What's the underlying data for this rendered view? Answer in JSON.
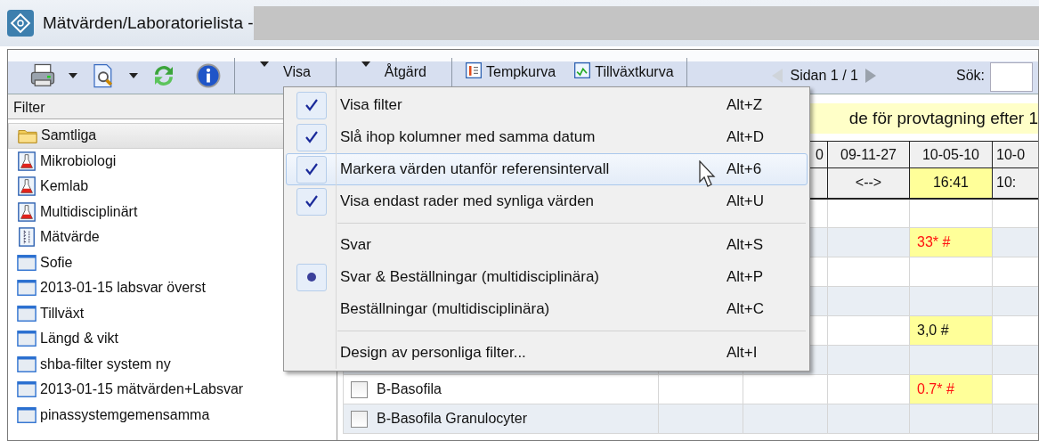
{
  "window": {
    "title": "Mätvärden/Laboratorielista -"
  },
  "toolbar": {
    "items": [
      {
        "kind": "printer"
      },
      {
        "kind": "caret"
      },
      {
        "kind": "preview"
      },
      {
        "kind": "caret"
      },
      {
        "kind": "refresh"
      },
      {
        "kind": "info"
      },
      {
        "kind": "separator"
      },
      {
        "kind": "menu",
        "label": "Visa"
      },
      {
        "kind": "separator"
      },
      {
        "kind": "menu",
        "label": "Åtgärd"
      },
      {
        "kind": "separator"
      },
      {
        "kind": "temp",
        "label": "Tempkurva"
      },
      {
        "kind": "growth",
        "label": "Tillväxtkurva"
      },
      {
        "kind": "separator"
      }
    ],
    "pager": {
      "label": "Sidan 1 / 1",
      "prev_disabled": true,
      "next_disabled": false
    },
    "search": {
      "label": "Sök:"
    }
  },
  "sidebar": {
    "header": "Filter",
    "items": [
      {
        "label": "Samtliga",
        "kind": "folder",
        "selected": true
      },
      {
        "label": "Mikrobiologi",
        "kind": "flask",
        "selected": false
      },
      {
        "label": "Kemlab",
        "kind": "flask",
        "selected": false
      },
      {
        "label": "Multidisciplinärt",
        "kind": "flask",
        "selected": false
      },
      {
        "label": "Mätvärde",
        "kind": "ruler",
        "selected": false
      },
      {
        "label": "Sofie",
        "kind": "window",
        "selected": false
      },
      {
        "label": "2013-01-15 labsvar överst",
        "kind": "window",
        "selected": false
      },
      {
        "label": "Tillväxt",
        "kind": "window",
        "selected": false
      },
      {
        "label": "Längd & vikt",
        "kind": "window",
        "selected": false
      },
      {
        "label": "shba-filter system ny",
        "kind": "window",
        "selected": false
      },
      {
        "label": "2013-01-15 mätvärden+Labsvar",
        "kind": "window",
        "selected": false
      },
      {
        "label": "pinassystemgemensamma",
        "kind": "window",
        "selected": false
      }
    ]
  },
  "banner": {
    "text": "de för provtagning efter 1"
  },
  "table": {
    "date_row": [
      "0",
      "09-11-27",
      "10-05-10",
      "10-0"
    ],
    "time_row": [
      {
        "text": "<-->",
        "highlight": false
      },
      {
        "text": "16:41",
        "highlight": true
      },
      {
        "text": "10:",
        "highlight": false
      }
    ],
    "rows": [
      {
        "cells": [
          null,
          null,
          null,
          null,
          null
        ]
      },
      {
        "cells": [
          null,
          null,
          null,
          {
            "text": "33* #",
            "highlight": true,
            "abnormal": true
          },
          null
        ]
      },
      {
        "cells": [
          null,
          null,
          null,
          null,
          null
        ]
      },
      {
        "cells": [
          null,
          null,
          null,
          null,
          null
        ]
      },
      {
        "cells": [
          null,
          null,
          null,
          {
            "text": "3,0 #",
            "highlight": true,
            "abnormal": false
          },
          null
        ]
      },
      {
        "cells": [
          null,
          null,
          null,
          null,
          null
        ]
      },
      {
        "name": "B-Basofila",
        "checked": false,
        "cells": [
          null,
          null,
          null,
          {
            "text": "0.7* #",
            "highlight": true,
            "abnormal": true
          },
          null
        ]
      },
      {
        "name": "B-Basofila Granulocyter",
        "checked": false,
        "cells": [
          null,
          null,
          null,
          null,
          null
        ]
      }
    ]
  },
  "menu": {
    "items": [
      {
        "kind": "check",
        "label": "Visa filter",
        "shortcut": "Alt+Z",
        "checked": true,
        "hovered": false
      },
      {
        "kind": "check",
        "label": "Slå ihop kolumner med samma datum",
        "shortcut": "Alt+D",
        "checked": true,
        "hovered": false
      },
      {
        "kind": "check",
        "label": "Markera värden utanför referensintervall",
        "shortcut": "Alt+6",
        "checked": true,
        "hovered": true
      },
      {
        "kind": "check",
        "label": "Visa endast rader med synliga värden",
        "shortcut": "Alt+U",
        "checked": true,
        "hovered": false
      },
      {
        "kind": "separator"
      },
      {
        "kind": "radio",
        "label": "Svar",
        "shortcut": "Alt+S",
        "selected": false,
        "hovered": false
      },
      {
        "kind": "radio",
        "label": "Svar & Beställningar (multidisciplinära)",
        "shortcut": "Alt+P",
        "selected": true,
        "hovered": false
      },
      {
        "kind": "radio",
        "label": "Beställningar (multidisciplinära)",
        "shortcut": "Alt+C",
        "selected": false,
        "hovered": false
      },
      {
        "kind": "separator"
      },
      {
        "kind": "command",
        "label": "Design av personliga filter...",
        "shortcut": "Alt+I",
        "hovered": false
      }
    ]
  }
}
